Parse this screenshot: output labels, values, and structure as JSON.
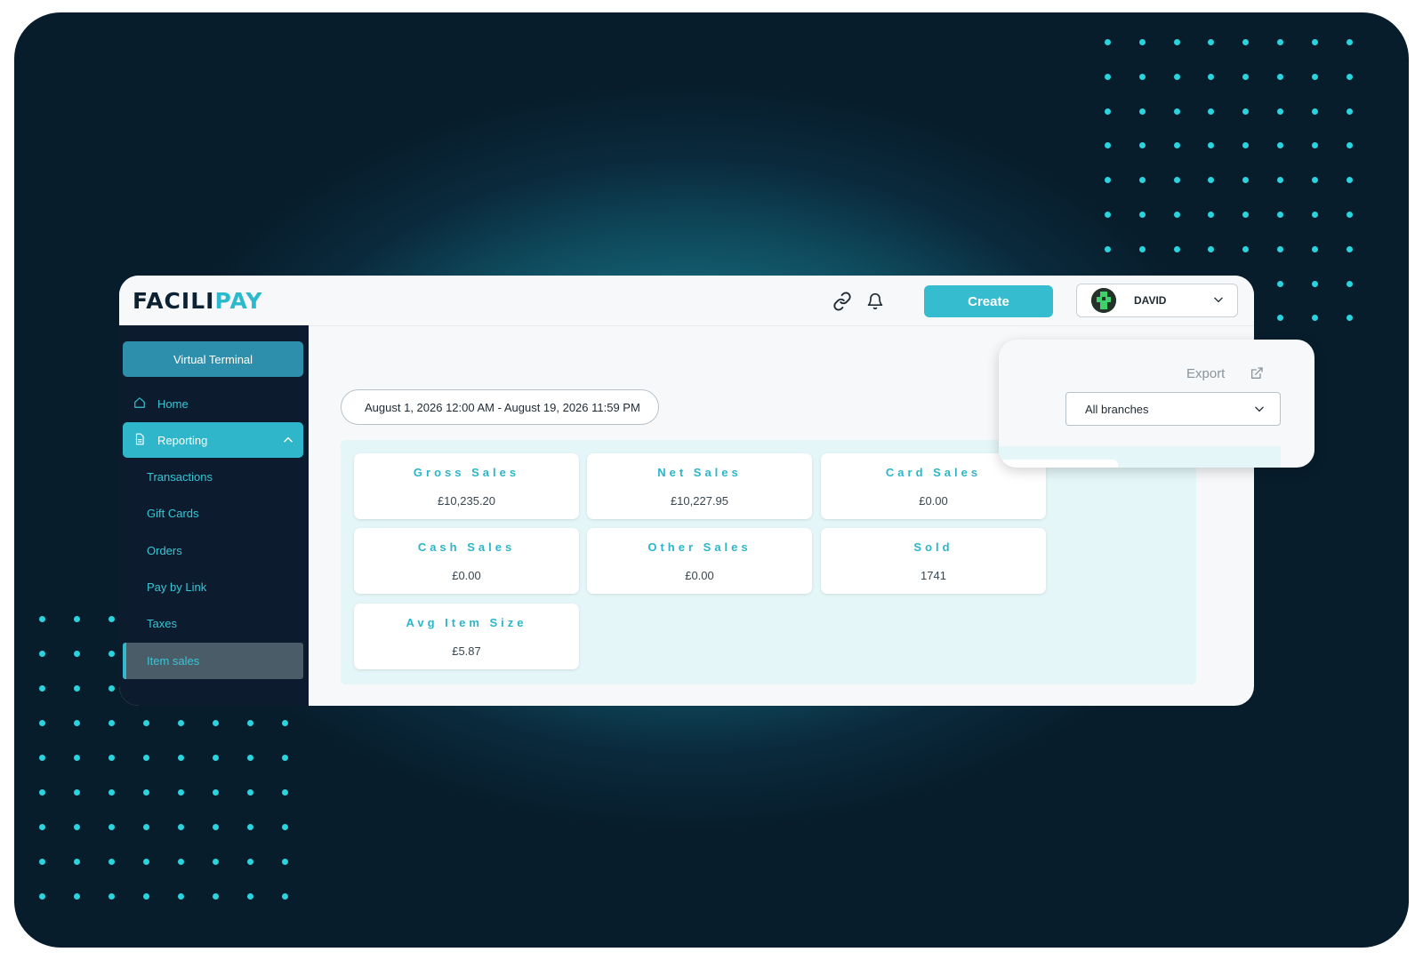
{
  "brand": {
    "logo_a": "FACILI",
    "logo_b": "PAY"
  },
  "header": {
    "link_icon": "link-icon",
    "bell_icon": "bell-icon",
    "create_label": "Create",
    "user_name": "DAVID"
  },
  "sidebar": {
    "virtual_terminal": "Virtual Terminal",
    "home": "Home",
    "reporting": "Reporting",
    "sub_items": [
      "Transactions",
      "Gift Cards",
      "Orders",
      "Pay by Link",
      "Taxes",
      "Item sales"
    ]
  },
  "main": {
    "date_range": "August 1, 2026 12:00 AM - August 19, 2026 11:59 PM",
    "cards": [
      {
        "title": "Gross Sales",
        "value": "£10,235.20"
      },
      {
        "title": "Net Sales",
        "value": "£10,227.95"
      },
      {
        "title": "Card Sales",
        "value": "£0.00"
      },
      {
        "title": "Cash Sales",
        "value": "£0.00"
      },
      {
        "title": "Other Sales",
        "value": "£0.00"
      },
      {
        "title": "Sold",
        "value": "1741"
      },
      {
        "title": "Avg Item Size",
        "value": "£5.87"
      }
    ]
  },
  "popover": {
    "export_label": "Export",
    "branch_select": "All branches"
  },
  "colors": {
    "accent": "#35bccf",
    "sidebar_bg": "#0c1c2e",
    "card_title": "#2bb5c9",
    "dot": "#2bd3df"
  }
}
